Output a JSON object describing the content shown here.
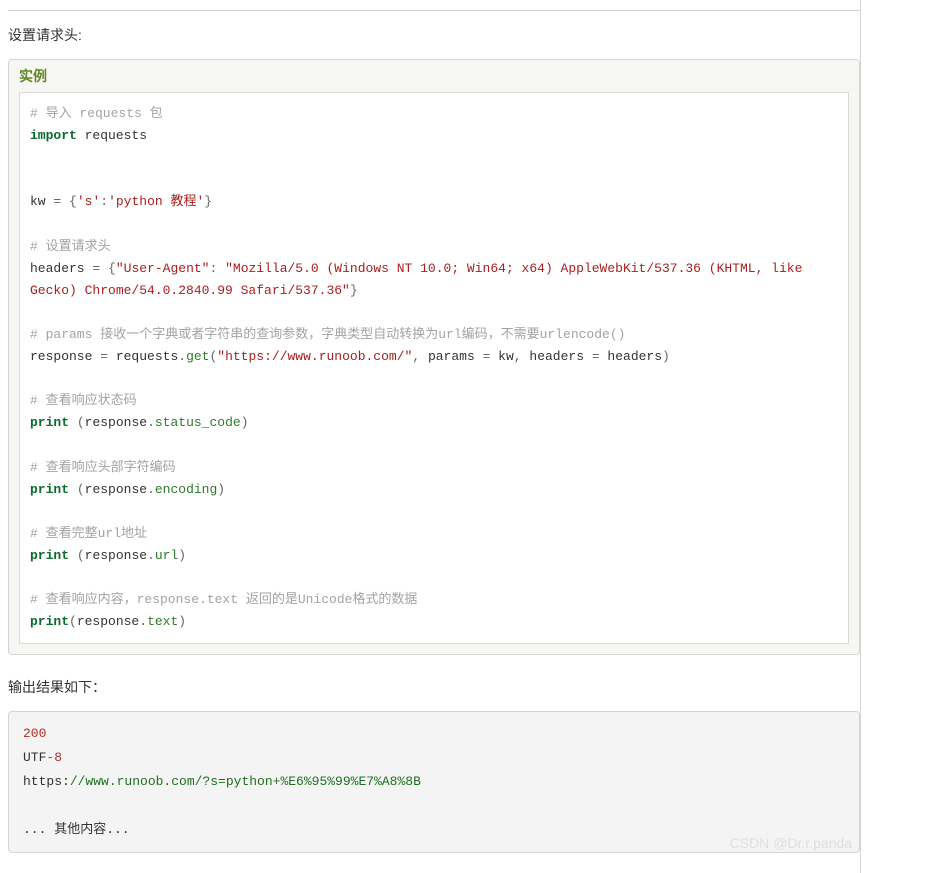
{
  "intro_text": "设置请求头:",
  "example": {
    "title": "实例",
    "tokens": [
      {
        "cls": "c-cmt",
        "t": "# 导入 requests 包"
      },
      {
        "cls": "br"
      },
      {
        "cls": "c-kw",
        "t": "import"
      },
      {
        "cls": "sp",
        "t": " "
      },
      {
        "cls": "c-nm",
        "t": "requests"
      },
      {
        "cls": "br"
      },
      {
        "cls": "br"
      },
      {
        "cls": "br"
      },
      {
        "cls": "c-nm",
        "t": "kw "
      },
      {
        "cls": "c-dot",
        "t": "="
      },
      {
        "cls": "c-nm",
        "t": " "
      },
      {
        "cls": "c-dot",
        "t": "{"
      },
      {
        "cls": "c-str",
        "t": "'s'"
      },
      {
        "cls": "c-dot",
        "t": ":"
      },
      {
        "cls": "c-str",
        "t": "'python 教程'"
      },
      {
        "cls": "c-dot",
        "t": "}"
      },
      {
        "cls": "br"
      },
      {
        "cls": "br"
      },
      {
        "cls": "c-cmt",
        "t": "# 设置请求头"
      },
      {
        "cls": "br"
      },
      {
        "cls": "c-nm",
        "t": "headers "
      },
      {
        "cls": "c-dot",
        "t": "="
      },
      {
        "cls": "c-nm",
        "t": " "
      },
      {
        "cls": "c-dot",
        "t": "{"
      },
      {
        "cls": "c-str",
        "t": "\"User-Agent\""
      },
      {
        "cls": "c-dot",
        "t": ": "
      },
      {
        "cls": "c-str",
        "t": "\"Mozilla/5.0 (Windows NT 10.0; Win64; x64) AppleWebKit/537.36 (KHTML, like Gecko) Chrome/54.0.2840.99 Safari/537.36\""
      },
      {
        "cls": "c-dot",
        "t": "}"
      },
      {
        "cls": "br"
      },
      {
        "cls": "br"
      },
      {
        "cls": "c-cmt",
        "t": "# params 接收一个字典或者字符串的查询参数，字典类型自动转换为url编码，不需要urlencode()"
      },
      {
        "cls": "br"
      },
      {
        "cls": "c-nm",
        "t": "response "
      },
      {
        "cls": "c-dot",
        "t": "="
      },
      {
        "cls": "c-nm",
        "t": " requests"
      },
      {
        "cls": "c-dot",
        "t": "."
      },
      {
        "cls": "c-attr",
        "t": "get"
      },
      {
        "cls": "c-dot",
        "t": "("
      },
      {
        "cls": "c-str",
        "t": "\"https://www.runoob.com/\""
      },
      {
        "cls": "c-dot",
        "t": ","
      },
      {
        "cls": "c-nm",
        "t": " params "
      },
      {
        "cls": "c-dot",
        "t": "="
      },
      {
        "cls": "c-nm",
        "t": " kw"
      },
      {
        "cls": "c-dot",
        "t": ","
      },
      {
        "cls": "c-nm",
        "t": " headers "
      },
      {
        "cls": "c-dot",
        "t": "="
      },
      {
        "cls": "c-nm",
        "t": " headers"
      },
      {
        "cls": "c-dot",
        "t": ")"
      },
      {
        "cls": "br"
      },
      {
        "cls": "br"
      },
      {
        "cls": "c-cmt",
        "t": "# 查看响应状态码"
      },
      {
        "cls": "br"
      },
      {
        "cls": "c-kw",
        "t": "print"
      },
      {
        "cls": "c-nm",
        "t": " "
      },
      {
        "cls": "c-dot",
        "t": "("
      },
      {
        "cls": "c-nm",
        "t": "response"
      },
      {
        "cls": "c-dot",
        "t": "."
      },
      {
        "cls": "c-attr",
        "t": "status_code"
      },
      {
        "cls": "c-dot",
        "t": ")"
      },
      {
        "cls": "br"
      },
      {
        "cls": "br"
      },
      {
        "cls": "c-cmt",
        "t": "# 查看响应头部字符编码"
      },
      {
        "cls": "br"
      },
      {
        "cls": "c-kw",
        "t": "print"
      },
      {
        "cls": "c-nm",
        "t": " "
      },
      {
        "cls": "c-dot",
        "t": "("
      },
      {
        "cls": "c-nm",
        "t": "response"
      },
      {
        "cls": "c-dot",
        "t": "."
      },
      {
        "cls": "c-attr",
        "t": "encoding"
      },
      {
        "cls": "c-dot",
        "t": ")"
      },
      {
        "cls": "br"
      },
      {
        "cls": "br"
      },
      {
        "cls": "c-cmt",
        "t": "# 查看完整url地址"
      },
      {
        "cls": "br"
      },
      {
        "cls": "c-kw",
        "t": "print"
      },
      {
        "cls": "c-nm",
        "t": " "
      },
      {
        "cls": "c-dot",
        "t": "("
      },
      {
        "cls": "c-nm",
        "t": "response"
      },
      {
        "cls": "c-dot",
        "t": "."
      },
      {
        "cls": "c-attr",
        "t": "url"
      },
      {
        "cls": "c-dot",
        "t": ")"
      },
      {
        "cls": "br"
      },
      {
        "cls": "br"
      },
      {
        "cls": "c-cmt",
        "t": "# 查看响应内容，response.text 返回的是Unicode格式的数据"
      },
      {
        "cls": "br"
      },
      {
        "cls": "c-kw",
        "t": "print"
      },
      {
        "cls": "c-dot",
        "t": "("
      },
      {
        "cls": "c-nm",
        "t": "response"
      },
      {
        "cls": "c-dot",
        "t": "."
      },
      {
        "cls": "c-attr",
        "t": "text"
      },
      {
        "cls": "c-dot",
        "t": ")"
      }
    ]
  },
  "output_label": "输出结果如下：",
  "output": {
    "line1_num": "200",
    "line2_a": "UTF",
    "line2_b": "-",
    "line2_c": "8",
    "line3_prot": "https:",
    "line3_rest": "//www.runoob.com/?s=python+%E6%95%99%E7%A8%8B",
    "line4": "... 其他内容...",
    "blank": ""
  },
  "watermark": "CSDN @Dr.r.panda"
}
